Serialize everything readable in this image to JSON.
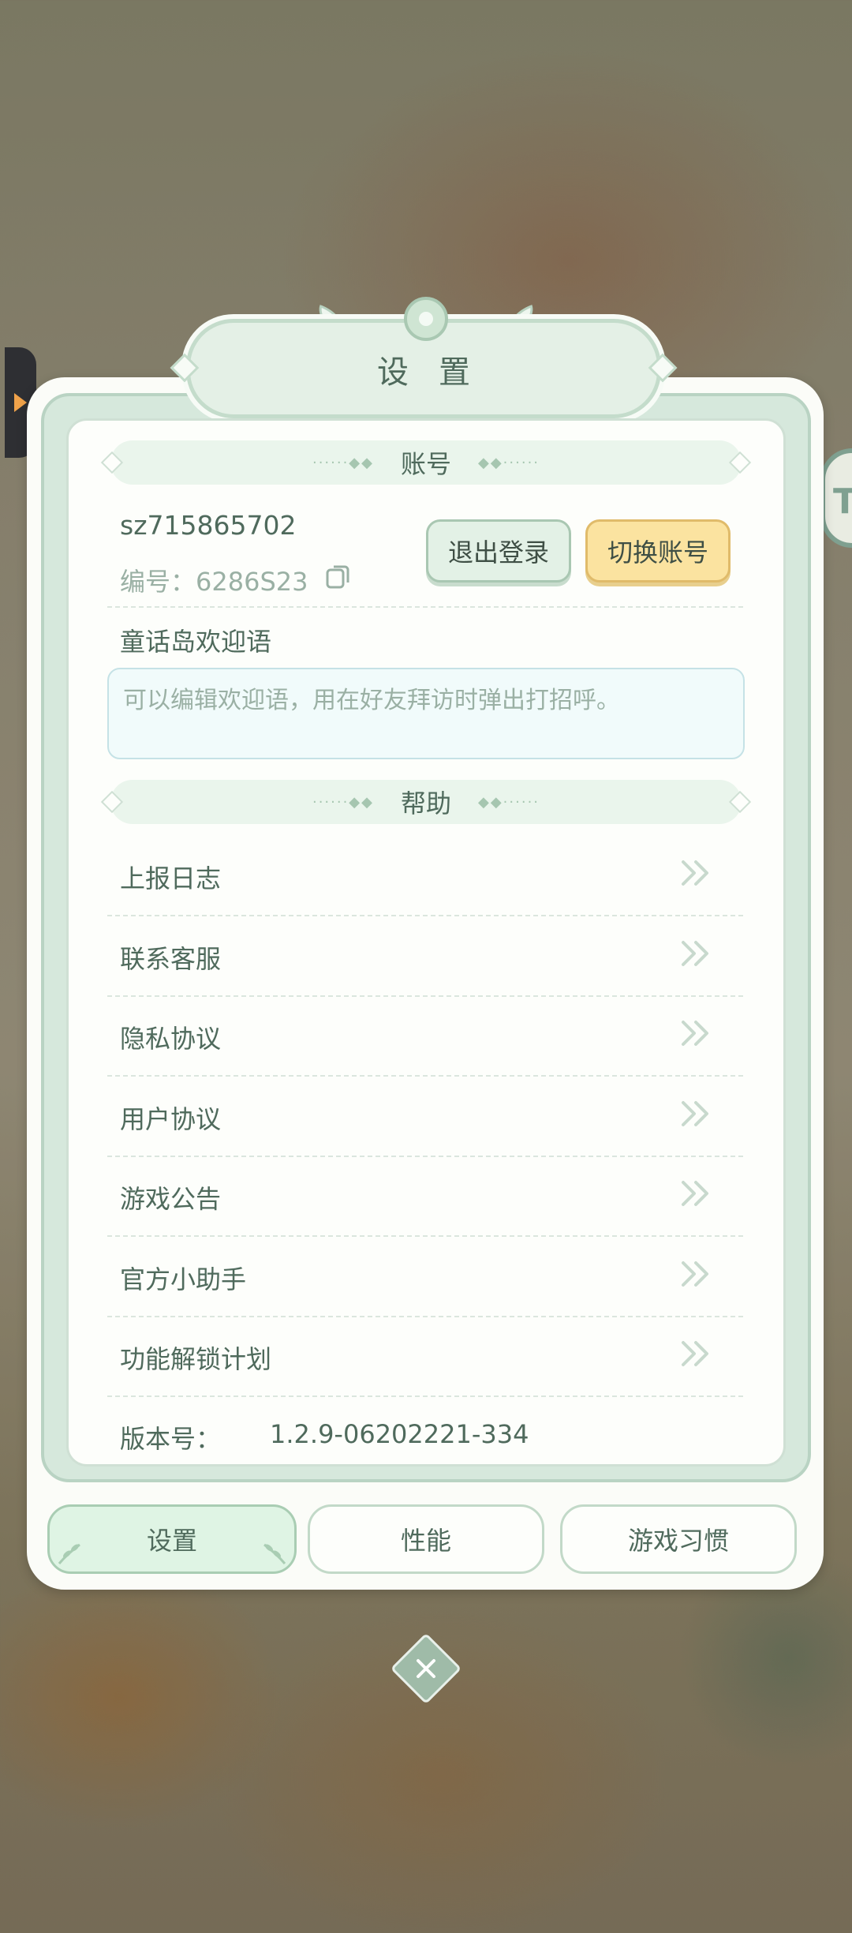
{
  "title": "设置",
  "sections": {
    "account": "账号",
    "help": "帮助"
  },
  "account": {
    "id": "sz715865702",
    "number_label": "编号：",
    "number_value": "6286S23",
    "logout_label": "退出登录",
    "switch_label": "切换账号"
  },
  "greeting": {
    "label": "童话岛欢迎语",
    "placeholder": "可以编辑欢迎语，用在好友拜访时弹出打招呼。"
  },
  "help_items": [
    {
      "label": "上报日志"
    },
    {
      "label": "联系客服"
    },
    {
      "label": "隐私协议"
    },
    {
      "label": "用户协议"
    },
    {
      "label": "游戏公告"
    },
    {
      "label": "官方小助手"
    },
    {
      "label": "功能解锁计划"
    }
  ],
  "version": {
    "label": "版本号：",
    "value": "1.2.9-06202221-334"
  },
  "tabs": [
    {
      "label": "设置",
      "active": true
    },
    {
      "label": "性能",
      "active": false
    },
    {
      "label": "游戏习惯",
      "active": false
    }
  ],
  "side_badge_text": "T",
  "colors": {
    "accent_green": "#a9c7b2",
    "accent_yellow": "#fbe3a0",
    "text": "#4f6a5c"
  },
  "icons": [
    "copy-icon",
    "chevron-double-right-icon",
    "close-icon",
    "arrow-right-icon",
    "flower-icon",
    "leaf-icon"
  ]
}
